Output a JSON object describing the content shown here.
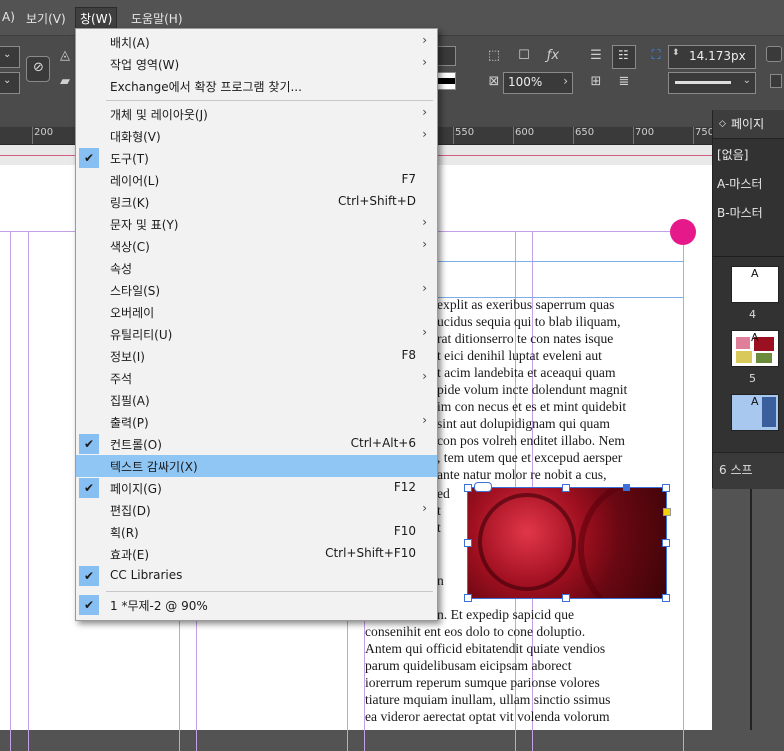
{
  "menubar": {
    "items": [
      {
        "label": "A)"
      },
      {
        "label": "보기(V)"
      },
      {
        "label": "창(W)"
      },
      {
        "label": "도움말(H)"
      }
    ]
  },
  "control": {
    "stroke_weight": "14.173px",
    "zoom": "100%"
  },
  "ruler": {
    "ticks": [
      "200",
      "550",
      "600",
      "650",
      "700",
      "750"
    ]
  },
  "pages_panel": {
    "tab_label": "페이지",
    "masters": [
      "[없음]",
      "A-마스터",
      "B-마스터"
    ],
    "thumb_letter": "A",
    "page_numbers": [
      "4",
      "5"
    ],
    "footer": "6 스프"
  },
  "window_menu": {
    "items": [
      {
        "label": "배치(A)",
        "shortcut": "",
        "submenu": true,
        "checked": false
      },
      {
        "label": "작업 영역(W)",
        "shortcut": "",
        "submenu": true,
        "checked": false
      },
      {
        "label": "Exchange에서 확장 프로그램 찾기...",
        "shortcut": "",
        "submenu": false,
        "checked": false
      },
      {
        "label": "개체 및 레이아웃(J)",
        "shortcut": "",
        "submenu": true,
        "checked": false
      },
      {
        "label": "대화형(V)",
        "shortcut": "",
        "submenu": true,
        "checked": false
      },
      {
        "label": "도구(T)",
        "shortcut": "",
        "submenu": false,
        "checked": true
      },
      {
        "label": "레이어(L)",
        "shortcut": "F7",
        "submenu": false,
        "checked": false
      },
      {
        "label": "링크(K)",
        "shortcut": "Ctrl+Shift+D",
        "submenu": false,
        "checked": false
      },
      {
        "label": "문자 및 표(Y)",
        "shortcut": "",
        "submenu": true,
        "checked": false
      },
      {
        "label": "색상(C)",
        "shortcut": "",
        "submenu": true,
        "checked": false
      },
      {
        "label": "속성",
        "shortcut": "",
        "submenu": false,
        "checked": false
      },
      {
        "label": "스타일(S)",
        "shortcut": "",
        "submenu": true,
        "checked": false
      },
      {
        "label": "오버레이",
        "shortcut": "",
        "submenu": false,
        "checked": false
      },
      {
        "label": "유틸리티(U)",
        "shortcut": "",
        "submenu": true,
        "checked": false
      },
      {
        "label": "정보(I)",
        "shortcut": "F8",
        "submenu": false,
        "checked": false
      },
      {
        "label": "주석",
        "shortcut": "",
        "submenu": true,
        "checked": false
      },
      {
        "label": "집필(A)",
        "shortcut": "",
        "submenu": false,
        "checked": false
      },
      {
        "label": "출력(P)",
        "shortcut": "",
        "submenu": true,
        "checked": false
      },
      {
        "label": "컨트롤(O)",
        "shortcut": "Ctrl+Alt+6",
        "submenu": false,
        "checked": true
      },
      {
        "label": "텍스트 감싸기(X)",
        "shortcut": "",
        "submenu": false,
        "checked": false,
        "highlighted": true
      },
      {
        "label": "페이지(G)",
        "shortcut": "F12",
        "submenu": false,
        "checked": true
      },
      {
        "label": "편집(D)",
        "shortcut": "",
        "submenu": true,
        "checked": false
      },
      {
        "label": "획(R)",
        "shortcut": "F10",
        "submenu": false,
        "checked": false
      },
      {
        "label": "효과(E)",
        "shortcut": "Ctrl+Shift+F10",
        "submenu": false,
        "checked": false
      },
      {
        "label": "CC Libraries",
        "shortcut": "",
        "submenu": false,
        "checked": true
      },
      {
        "label": "1 *무제-2 @ 90%",
        "shortcut": "",
        "submenu": false,
        "checked": true
      }
    ]
  },
  "document": {
    "text_lines": [
      "explit as exeribus saperrum quas",
      "ucidus sequia qui to blab iliquam,",
      "rat ditionserro te con nates isque",
      "t eici denihil luptat eveleni aut",
      "t acim landebita et aceaqui quam",
      "pide volum incte dolendunt magnit",
      "im con necus et es et mint quidebit",
      "sint aut dolupidignam qui quam",
      "con pos volreh enditet illabo. Nem",
      ", tem utem que et excepud aersper",
      "ante natur molor re nobit a cus,",
      "ed",
      "t",
      "t",
      "",
      "n",
      "",
      "n. Et expedip sapicid que",
      "consenihit ent eos dolo to cone doluptio.",
      "Antem qui officid ebitatendit quiate vendios",
      "parum quidelibusam eicipsam aborect",
      "iorerrum reperum sumque parionse volores",
      "tiature mquiam inullam, ullam sinctio ssimus",
      "ea videror aerectat optat vit volenda volorum"
    ]
  }
}
